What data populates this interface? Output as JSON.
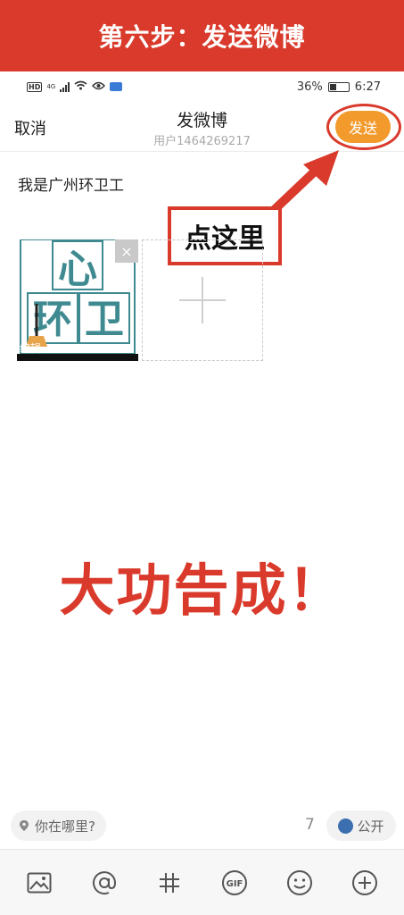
{
  "banner": {
    "title": "第六步：发送微博"
  },
  "status": {
    "hd": "HD",
    "signal": "4G",
    "battery": "36%",
    "time": "6:27"
  },
  "nav": {
    "cancel": "取消",
    "title": "发微博",
    "subtitle": "用户1464269217",
    "send": "发送"
  },
  "compose": {
    "text": "我是广州环卫工"
  },
  "image": {
    "close": "×",
    "edit": "编辑",
    "logo_chars": [
      "心",
      "环",
      "卫"
    ]
  },
  "callout": {
    "text": "点这里"
  },
  "success": {
    "text": "大功告成！"
  },
  "footer": {
    "location": "你在哪里?",
    "count": "7",
    "privacy": "公开"
  },
  "toolbar": {
    "items": [
      "picture-icon",
      "mention-icon",
      "hashtag-icon",
      "gif-icon",
      "emoji-icon",
      "more-icon"
    ],
    "gif": "GIF"
  },
  "colors": {
    "banner": "#d93a2b",
    "send": "#f39a2d",
    "accent": "#d93a2b",
    "logo": "#3f8a91"
  }
}
